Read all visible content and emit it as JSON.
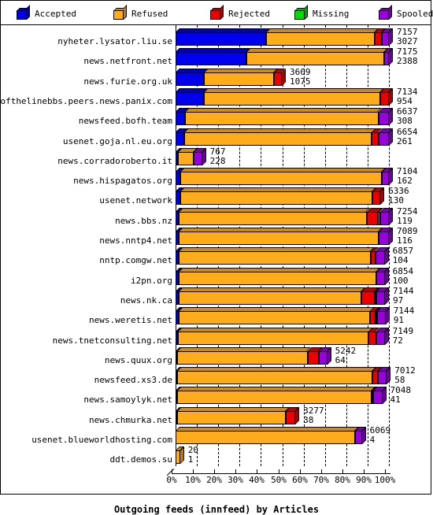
{
  "legend": {
    "items": [
      {
        "label": "Accepted",
        "color": "#0000ee",
        "icon": "cube-icon"
      },
      {
        "label": "Refused",
        "color": "#ffac1c",
        "icon": "cube-icon"
      },
      {
        "label": "Rejected",
        "color": "#ee0000",
        "icon": "cube-icon"
      },
      {
        "label": "Missing",
        "color": "#00dd00",
        "icon": "cube-icon"
      },
      {
        "label": "Spooled",
        "color": "#9900dd",
        "icon": "cube-icon"
      }
    ]
  },
  "axis": {
    "title": "Outgoing feeds (innfeed) by Articles",
    "ticks": [
      "0%",
      "10%",
      "20%",
      "30%",
      "40%",
      "50%",
      "60%",
      "70%",
      "80%",
      "90%",
      "100%"
    ]
  },
  "colors": {
    "accepted": "#0000ee",
    "refused": "#ffac1c",
    "rejected": "#ee0000",
    "missing": "#cc33cc",
    "spooled": "#9900dd",
    "outline": "#000000",
    "background": "#ffffff"
  },
  "chart_data": {
    "type": "bar",
    "orientation": "horizontal",
    "stacked": true,
    "normalized": true,
    "title": "Outgoing feeds (innfeed) by Articles",
    "xlabel": "",
    "ylabel": "",
    "xlim": [
      0,
      100
    ],
    "xunit": "%",
    "grid": true,
    "legend_position": "top",
    "series_names": [
      "Accepted",
      "Refused",
      "Rejected",
      "Missing",
      "Spooled"
    ],
    "categories": [
      "nyheter.lysator.liu.se",
      "news.netfront.net",
      "news.furie.org.uk",
      "endofthelinebbs.peers.news.panix.com",
      "newsfeed.bofh.team",
      "usenet.goja.nl.eu.org",
      "news.corradoroberto.it",
      "news.hispagatos.org",
      "usenet.network",
      "news.bbs.nz",
      "news.nntp4.net",
      "nntp.comgw.net",
      "i2pn.org",
      "news.nk.ca",
      "news.weretis.net",
      "news.tnetconsulting.net",
      "news.quux.org",
      "newsfeed.xs3.de",
      "news.samoylyk.net",
      "news.chmurka.net",
      "usenet.blueworldhosting.com",
      "ddt.demos.su"
    ],
    "rows": [
      {
        "label": "nyheter.lysator.liu.se",
        "total": 7157,
        "second": 3027,
        "fractions": {
          "accepted": 42.3,
          "refused": 51.0,
          "rejected": 3.4,
          "missing": 0.0,
          "spooled": 3.3
        }
      },
      {
        "label": "news.netfront.net",
        "total": 7175,
        "second": 2388,
        "fractions": {
          "accepted": 33.3,
          "refused": 64.4,
          "rejected": 0.0,
          "missing": 0.0,
          "spooled": 2.3
        }
      },
      {
        "label": "news.furie.org.uk",
        "total": 3609,
        "second": 1075,
        "fractions": {
          "accepted": 13.3,
          "refused": 33.0,
          "rejected": 3.5,
          "missing": 0.0,
          "spooled": 0.0
        }
      },
      {
        "label": "endofthelinebbs.peers.news.panix.com",
        "total": 7134,
        "second": 954,
        "fractions": {
          "accepted": 13.4,
          "refused": 82.5,
          "rejected": 4.1,
          "missing": 0.0,
          "spooled": 0.0
        }
      },
      {
        "label": "newsfeed.bofh.team",
        "total": 6637,
        "second": 308,
        "fractions": {
          "accepted": 4.6,
          "refused": 90.5,
          "rejected": 0.0,
          "missing": 0.0,
          "spooled": 4.9
        }
      },
      {
        "label": "usenet.goja.nl.eu.org",
        "total": 6654,
        "second": 261,
        "fractions": {
          "accepted": 3.9,
          "refused": 88.1,
          "rejected": 3.1,
          "missing": 0.0,
          "spooled": 4.9
        }
      },
      {
        "label": "news.corradoroberto.it",
        "total": 767,
        "second": 228,
        "fractions": {
          "accepted": 1.0,
          "refused": 7.4,
          "rejected": 0.0,
          "missing": 0.0,
          "spooled": 4.0
        }
      },
      {
        "label": "news.hispagatos.org",
        "total": 7104,
        "second": 162,
        "fractions": {
          "accepted": 2.3,
          "refused": 94.5,
          "rejected": 0.0,
          "missing": 0.0,
          "spooled": 3.2
        }
      },
      {
        "label": "usenet.network",
        "total": 6336,
        "second": 130,
        "fractions": {
          "accepted": 2.1,
          "refused": 90.2,
          "rejected": 3.7,
          "missing": 0.0,
          "spooled": 0.0
        }
      },
      {
        "label": "news.bbs.nz",
        "total": 7254,
        "second": 119,
        "fractions": {
          "accepted": 1.6,
          "refused": 88.0,
          "rejected": 5.4,
          "missing": 0.9,
          "spooled": 4.1
        }
      },
      {
        "label": "news.nntp4.net",
        "total": 7089,
        "second": 116,
        "fractions": {
          "accepted": 1.6,
          "refused": 93.7,
          "rejected": 0.0,
          "missing": 0.0,
          "spooled": 4.7
        }
      },
      {
        "label": "nntp.comgw.net",
        "total": 6857,
        "second": 104,
        "fractions": {
          "accepted": 1.5,
          "refused": 90.1,
          "rejected": 2.0,
          "missing": 0.0,
          "spooled": 4.4
        }
      },
      {
        "label": "i2pn.org",
        "total": 6854,
        "second": 100,
        "fractions": {
          "accepted": 1.5,
          "refused": 92.5,
          "rejected": 0.0,
          "missing": 0.0,
          "spooled": 4.0
        }
      },
      {
        "label": "news.nk.ca",
        "total": 7144,
        "second": 97,
        "fractions": {
          "accepted": 1.4,
          "refused": 85.6,
          "rejected": 6.4,
          "missing": 0.6,
          "spooled": 4.0
        }
      },
      {
        "label": "news.weretis.net",
        "total": 7144,
        "second": 91,
        "fractions": {
          "accepted": 1.3,
          "refused": 90.0,
          "rejected": 2.4,
          "missing": 0.3,
          "spooled": 4.0
        }
      },
      {
        "label": "news.tnetconsulting.net",
        "total": 7149,
        "second": 72,
        "fractions": {
          "accepted": 1.0,
          "refused": 89.5,
          "rejected": 3.5,
          "missing": 0.0,
          "spooled": 4.0
        }
      },
      {
        "label": "news.quux.org",
        "total": 5242,
        "second": 64,
        "fractions": {
          "accepted": 0.9,
          "refused": 61.0,
          "rejected": 5.2,
          "missing": 0.0,
          "spooled": 4.0
        }
      },
      {
        "label": "newsfeed.xs3.de",
        "total": 7012,
        "second": 58,
        "fractions": {
          "accepted": 0.8,
          "refused": 91.6,
          "rejected": 2.6,
          "missing": 0.0,
          "spooled": 4.0
        }
      },
      {
        "label": "news.samoylyk.net",
        "total": 7048,
        "second": 41,
        "fractions": {
          "accepted": 0.6,
          "refused": 91.1,
          "rejected": 0.5,
          "missing": 0.0,
          "spooled": 4.3
        }
      },
      {
        "label": "news.chmurka.net",
        "total": 3277,
        "second": 38,
        "fractions": {
          "accepted": 0.5,
          "refused": 51.0,
          "rejected": 4.4,
          "missing": 0.0,
          "spooled": 0.0
        }
      },
      {
        "label": "usenet.blueworldhosting.com",
        "total": 6069,
        "second": 4,
        "fractions": {
          "accepted": 0.0,
          "refused": 84.0,
          "rejected": 0.0,
          "missing": 0.0,
          "spooled": 3.3
        }
      },
      {
        "label": "ddt.demos.su",
        "total": 20,
        "second": 1,
        "fractions": {
          "accepted": 0.0,
          "refused": 2.1,
          "rejected": 0.0,
          "missing": 0.0,
          "spooled": 0.0
        }
      }
    ]
  }
}
